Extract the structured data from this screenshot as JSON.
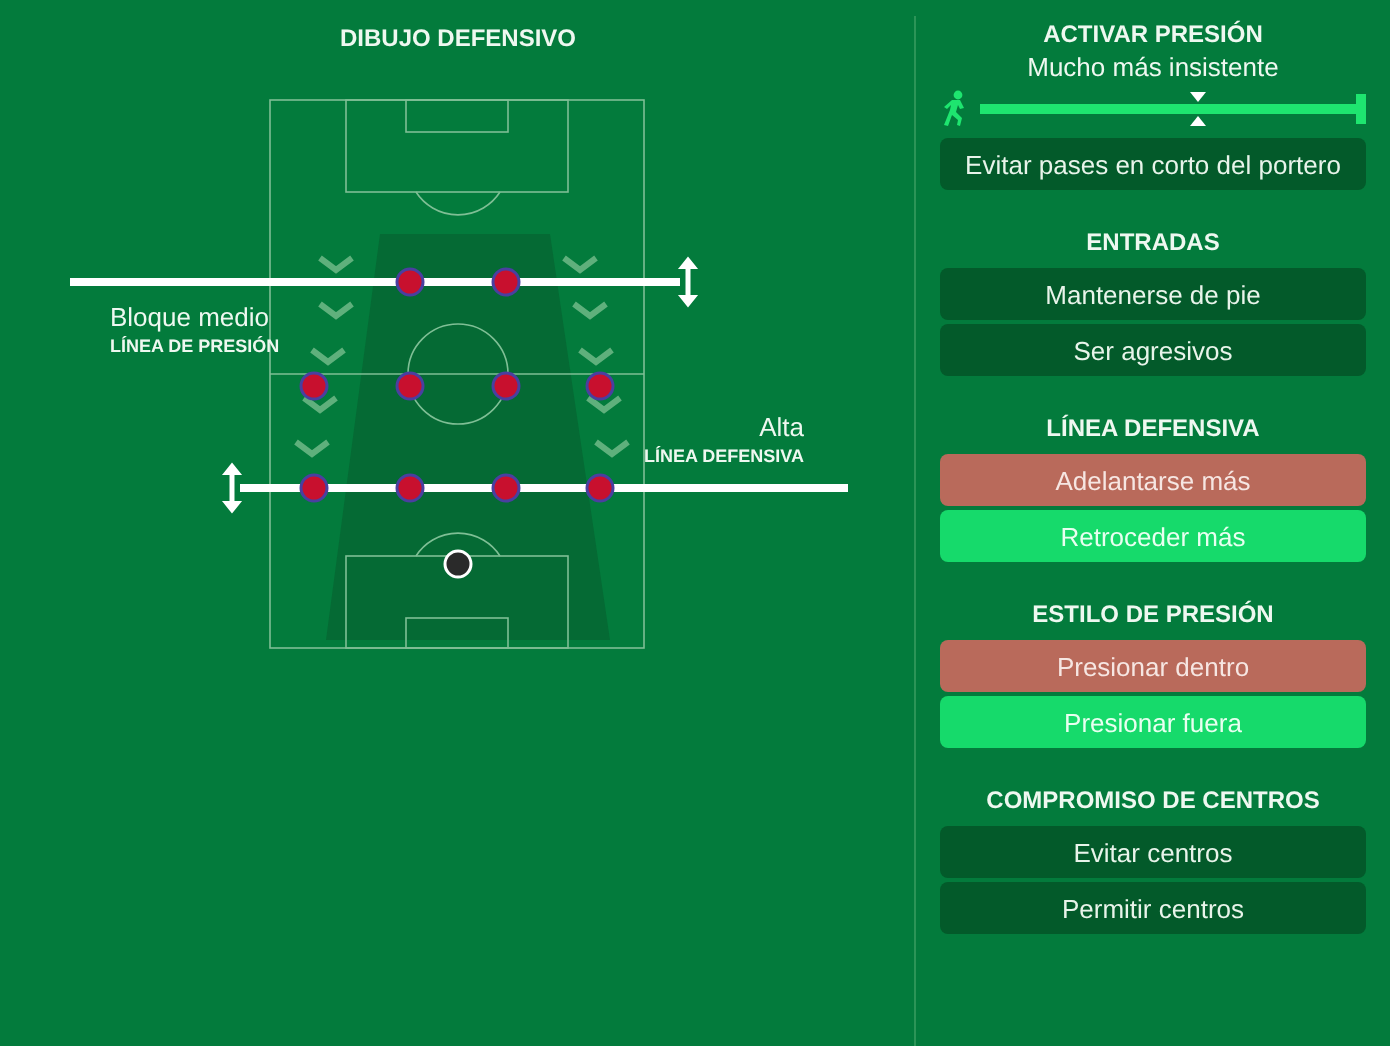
{
  "left": {
    "title": "DIBUJO DEFENSIVO",
    "pressing_line": {
      "value": "Bloque medio",
      "label": "LÍNEA DE PRESIÓN"
    },
    "defensive_line": {
      "value": "Alta",
      "label": "LÍNEA DEFENSIVA"
    }
  },
  "sections": [
    {
      "kind": "slider",
      "title": "ACTIVAR PRESIÓN",
      "reading": "Mucho más insistente",
      "level": 0.58,
      "buttons": [
        {
          "label": "Evitar pases en corto del portero",
          "selected": false,
          "disabled": false
        }
      ]
    },
    {
      "kind": "buttons",
      "title": "ENTRADAS",
      "buttons": [
        {
          "label": "Mantenerse de pie",
          "selected": false,
          "disabled": false
        },
        {
          "label": "Ser agresivos",
          "selected": false,
          "disabled": false
        }
      ]
    },
    {
      "kind": "buttons",
      "title": "LÍNEA DEFENSIVA",
      "buttons": [
        {
          "label": "Adelantarse más",
          "selected": false,
          "disabled": true
        },
        {
          "label": "Retroceder más",
          "selected": true,
          "disabled": false
        }
      ]
    },
    {
      "kind": "buttons",
      "title": "ESTILO DE PRESIÓN",
      "buttons": [
        {
          "label": "Presionar dentro",
          "selected": false,
          "disabled": true
        },
        {
          "label": "Presionar fuera",
          "selected": true,
          "disabled": false
        }
      ]
    },
    {
      "kind": "buttons",
      "title": "COMPROMISO DE CENTROS",
      "buttons": [
        {
          "label": "Evitar centros",
          "selected": false,
          "disabled": false
        },
        {
          "label": "Permitir centros",
          "selected": false,
          "disabled": false
        }
      ]
    }
  ]
}
